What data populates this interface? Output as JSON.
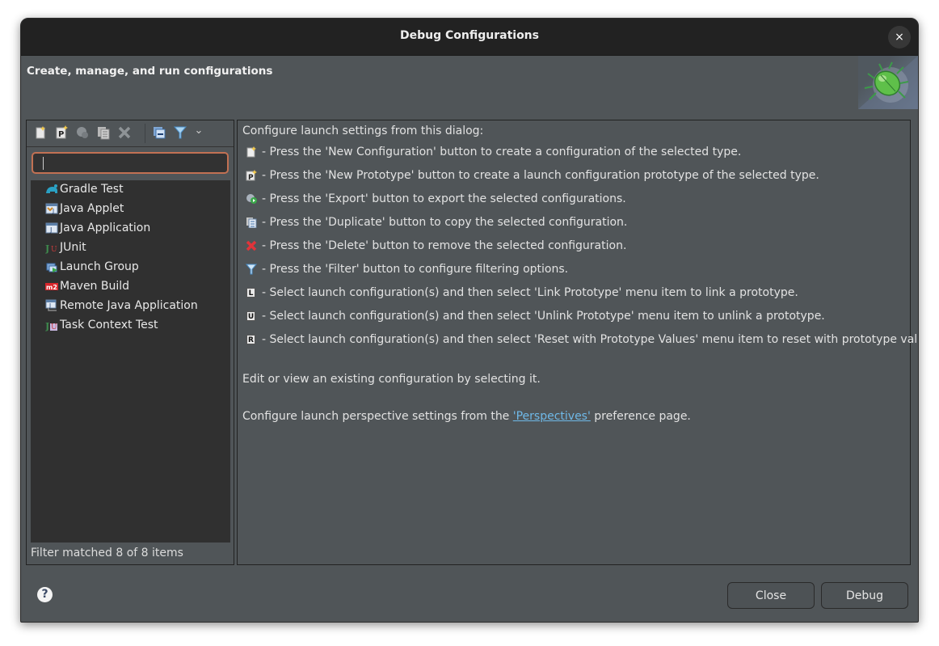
{
  "window": {
    "title": "Debug Configurations",
    "close_icon": "×"
  },
  "header": {
    "title": "Create, manage, and run configurations",
    "banner_icon": "debug-bug-icon"
  },
  "toolbar": {
    "buttons": [
      {
        "name": "new-configuration",
        "icon": "new-config-icon"
      },
      {
        "name": "new-prototype",
        "icon": "new-prototype-icon"
      },
      {
        "name": "export",
        "icon": "export-icon"
      },
      {
        "name": "duplicate",
        "icon": "duplicate-icon"
      },
      {
        "name": "delete",
        "icon": "delete-icon"
      },
      {
        "name": "collapse-all",
        "icon": "collapse-all-icon"
      },
      {
        "name": "filter",
        "icon": "filter-icon"
      },
      {
        "name": "view-menu",
        "icon": "chevron-down-icon"
      }
    ],
    "chevron": "⌄"
  },
  "filter": {
    "value": "",
    "placeholder": ""
  },
  "tree": {
    "items": [
      {
        "label": "Gradle Test",
        "icon": "gradle-icon"
      },
      {
        "label": "Java Applet",
        "icon": "java-applet-icon"
      },
      {
        "label": "Java Application",
        "icon": "java-application-icon"
      },
      {
        "label": "JUnit",
        "icon": "junit-icon"
      },
      {
        "label": "Launch Group",
        "icon": "launch-group-icon"
      },
      {
        "label": "Maven Build",
        "icon": "maven-icon"
      },
      {
        "label": "Remote Java Application",
        "icon": "remote-java-icon"
      },
      {
        "label": "Task Context Test",
        "icon": "task-context-icon"
      }
    ],
    "status": "Filter matched 8 of 8 items"
  },
  "info": {
    "intro": "Configure launch settings from this dialog:",
    "items": [
      {
        "icon": "new-config-icon",
        "text": "- Press the 'New Configuration' button to create a configuration of the selected type."
      },
      {
        "icon": "new-prototype-icon",
        "text": "- Press the 'New Prototype' button to create a launch configuration prototype of the selected type."
      },
      {
        "icon": "export-icon",
        "text": "- Press the 'Export' button to export the selected configurations."
      },
      {
        "icon": "duplicate-icon",
        "text": "- Press the 'Duplicate' button to copy the selected configuration."
      },
      {
        "icon": "delete-icon",
        "text": "- Press the 'Delete' button to remove the selected configuration."
      },
      {
        "icon": "filter-icon",
        "text": "- Press the 'Filter' button to configure filtering options."
      },
      {
        "icon": "link-prototype-icon",
        "badge": "L",
        "text": "- Select launch configuration(s) and then select 'Link Prototype' menu item to link a prototype."
      },
      {
        "icon": "unlink-prototype-icon",
        "badge": "U",
        "text": "- Select launch configuration(s) and then select 'Unlink Prototype' menu item to unlink a prototype."
      },
      {
        "icon": "reset-prototype-icon",
        "badge": "R",
        "text": "- Select launch configuration(s) and then select 'Reset with Prototype Values' menu item to reset with prototype values."
      }
    ],
    "edit_text": "Edit or view an existing configuration by selecting it.",
    "perspective_prefix": "Configure launch perspective settings from the ",
    "perspective_link": "'Perspectives'",
    "perspective_suffix": " preference page."
  },
  "footer": {
    "help_icon": "?",
    "close_label": "Close",
    "debug_label": "Debug"
  }
}
